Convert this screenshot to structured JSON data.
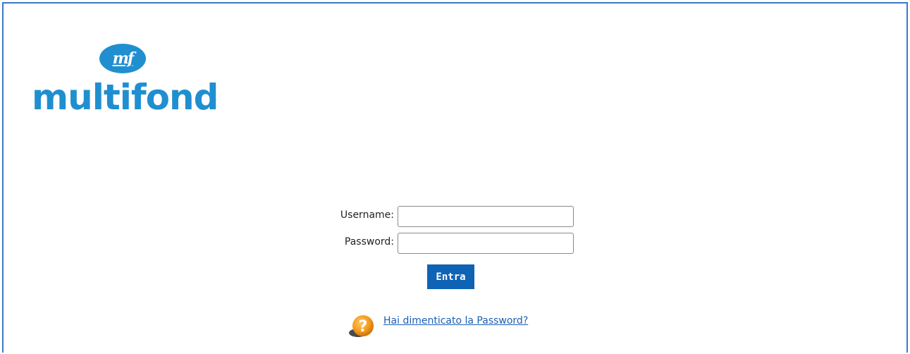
{
  "brand": {
    "badge_text": "mf",
    "name": "multifond",
    "color": "#1f8fd0"
  },
  "login": {
    "username_label": "Username:",
    "username_value": "",
    "password_label": "Password:",
    "password_value": "",
    "submit_label": "Entra",
    "submit_color": "#0f63b5",
    "forgot_label": "Hai dimenticato la Password?",
    "forgot_icon": "help-question-icon"
  },
  "frame_color": "#3a7bc8"
}
